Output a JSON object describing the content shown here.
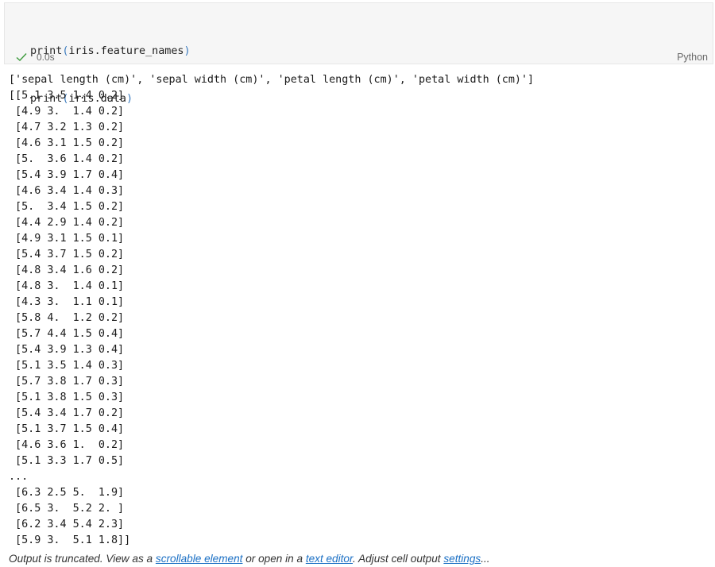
{
  "code_cell": {
    "lines": [
      {
        "fn": "print",
        "open": "(",
        "arg": "iris.feature_names",
        "close": ")"
      },
      {
        "fn": "print",
        "open": "(",
        "arg": "iris.data",
        "close": ")"
      }
    ],
    "exec_time": "0.0s",
    "language": "Python"
  },
  "output": {
    "lines": [
      "['sepal length (cm)', 'sepal width (cm)', 'petal length (cm)', 'petal width (cm)']",
      "[[5.1 3.5 1.4 0.2]",
      " [4.9 3.  1.4 0.2]",
      " [4.7 3.2 1.3 0.2]",
      " [4.6 3.1 1.5 0.2]",
      " [5.  3.6 1.4 0.2]",
      " [5.4 3.9 1.7 0.4]",
      " [4.6 3.4 1.4 0.3]",
      " [5.  3.4 1.5 0.2]",
      " [4.4 2.9 1.4 0.2]",
      " [4.9 3.1 1.5 0.1]",
      " [5.4 3.7 1.5 0.2]",
      " [4.8 3.4 1.6 0.2]",
      " [4.8 3.  1.4 0.1]",
      " [4.3 3.  1.1 0.1]",
      " [5.8 4.  1.2 0.2]",
      " [5.7 4.4 1.5 0.4]",
      " [5.4 3.9 1.3 0.4]",
      " [5.1 3.5 1.4 0.3]",
      " [5.7 3.8 1.7 0.3]",
      " [5.1 3.8 1.5 0.3]",
      " [5.4 3.4 1.7 0.2]",
      " [5.1 3.7 1.5 0.4]",
      " [4.6 3.6 1.  0.2]",
      " [5.1 3.3 1.7 0.5]",
      "...",
      " [6.3 2.5 5.  1.9]",
      " [6.5 3.  5.2 2. ]",
      " [6.2 3.4 5.4 2.3]",
      " [5.9 3.  5.1 1.8]]"
    ]
  },
  "truncation": {
    "prefix": "Output is truncated. View as a ",
    "link_scrollable": "scrollable element",
    "middle": " or open in a ",
    "link_editor": "text editor",
    "middle2": ". Adjust cell output ",
    "link_settings": "settings",
    "suffix": "..."
  },
  "colors": {
    "link": "#1a6fc4",
    "success_check": "#3c9a3c"
  },
  "icons": {
    "status": "check-icon"
  }
}
